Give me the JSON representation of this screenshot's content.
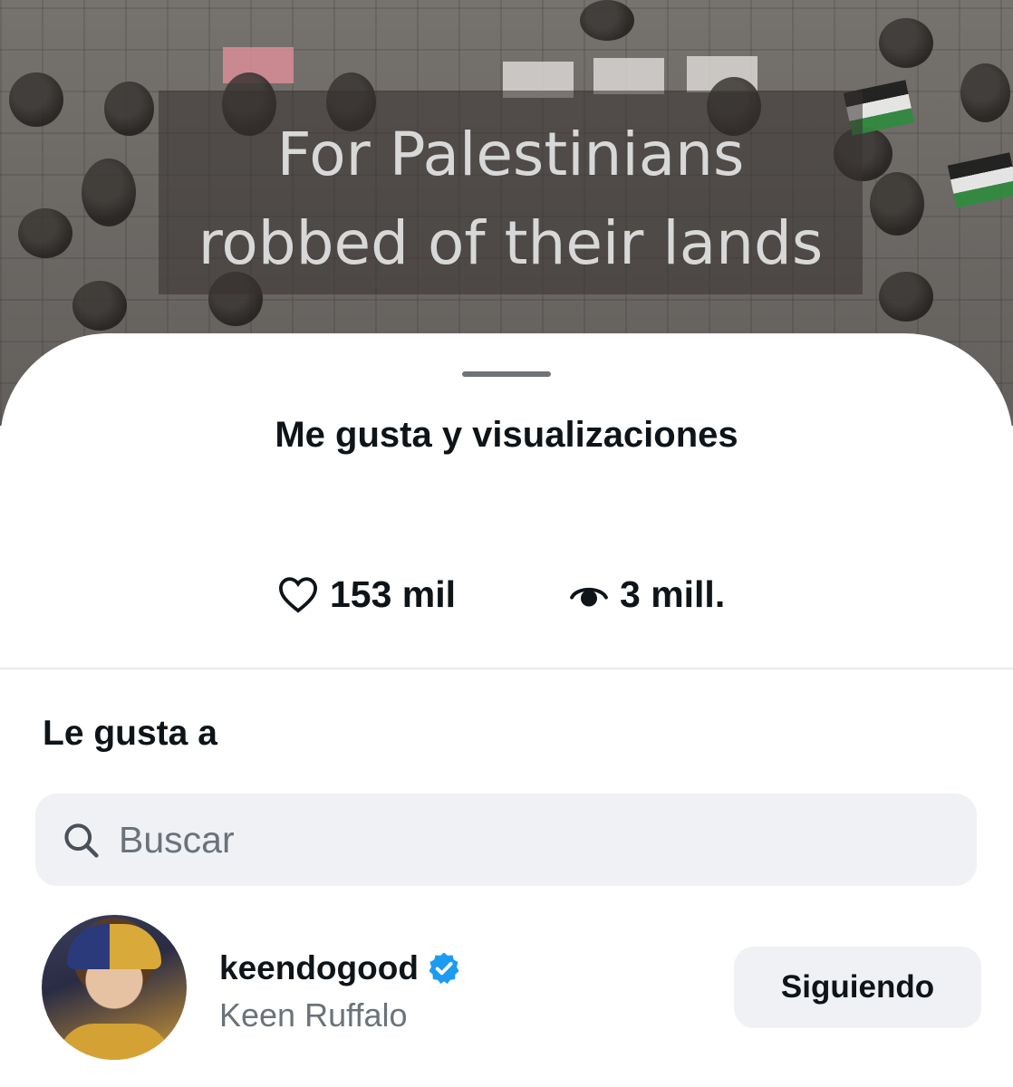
{
  "video": {
    "caption_line1": "For Palestinians",
    "caption_line2": "robbed of their lands"
  },
  "sheet": {
    "title": "Me gusta y visualizaciones",
    "likes": {
      "icon": "heart-outline-icon",
      "value": "153 mil"
    },
    "views": {
      "icon": "eye-icon",
      "value": "3 mill."
    },
    "section_heading": "Le gusta a",
    "search": {
      "icon": "search-icon",
      "placeholder": "Buscar",
      "value": ""
    },
    "users": [
      {
        "handle": "keendogood",
        "verified": true,
        "verified_color": "#1d9bf0",
        "display_name": "Keen Ruffalo",
        "button_label": "Siguiendo"
      }
    ]
  }
}
